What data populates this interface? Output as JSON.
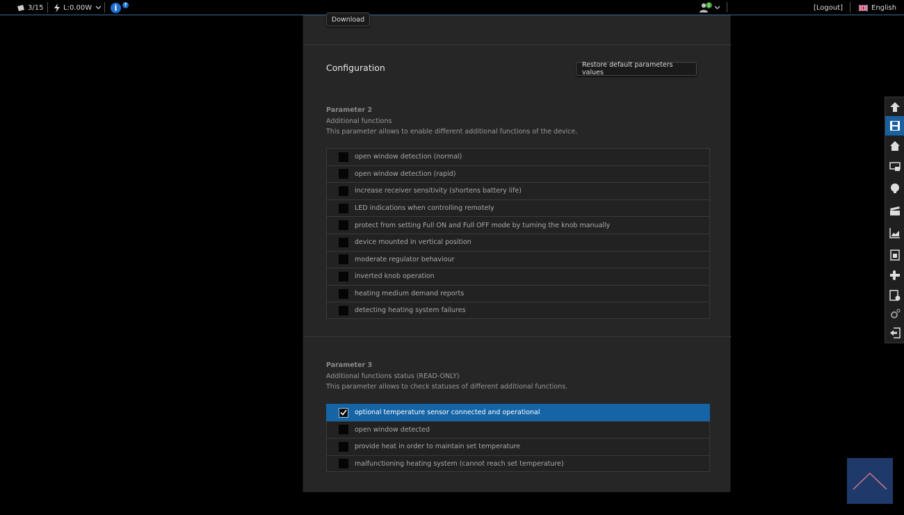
{
  "topbar": {
    "devices": "3/15",
    "power": "L:0.00W",
    "info": "i",
    "help": "?",
    "notifications": "0",
    "logout": "[Logout]",
    "language": "English"
  },
  "download_label": "Download",
  "configuration": {
    "title": "Configuration",
    "restore_label": "Restore default parameters values"
  },
  "param2": {
    "title": "Parameter 2",
    "name": "Additional functions",
    "description": "This parameter allows to enable different additional functions of the device.",
    "options": [
      {
        "label": "open window detection (normal)",
        "checked": false
      },
      {
        "label": "open window detection (rapid)",
        "checked": false
      },
      {
        "label": "increase receiver sensitivity (shortens battery life)",
        "checked": false
      },
      {
        "label": "LED indications when controlling remotely",
        "checked": false
      },
      {
        "label": "protect from setting Full ON and Full OFF mode by turning the knob manually",
        "checked": false
      },
      {
        "label": "device mounted in vertical position",
        "checked": false
      },
      {
        "label": "moderate regulator behaviour",
        "checked": false
      },
      {
        "label": "inverted knob operation",
        "checked": false
      },
      {
        "label": "heating medium demand reports",
        "checked": false
      },
      {
        "label": "detecting heating system failures",
        "checked": false
      }
    ]
  },
  "param3": {
    "title": "Parameter 3",
    "name": "Additional functions status (READ-ONLY)",
    "description": "This parameter allows to check statuses of different additional functions.",
    "options": [
      {
        "label": "optional temperature sensor connected and operational",
        "checked": true
      },
      {
        "label": "open window detected",
        "checked": false
      },
      {
        "label": "provide heat in order to maintain set temperature",
        "checked": false
      },
      {
        "label": "malfunctioning heating system (cannot reach set temperature)",
        "checked": false
      }
    ]
  },
  "colors": {
    "accent": "#1564a6",
    "panel": "#262626"
  }
}
